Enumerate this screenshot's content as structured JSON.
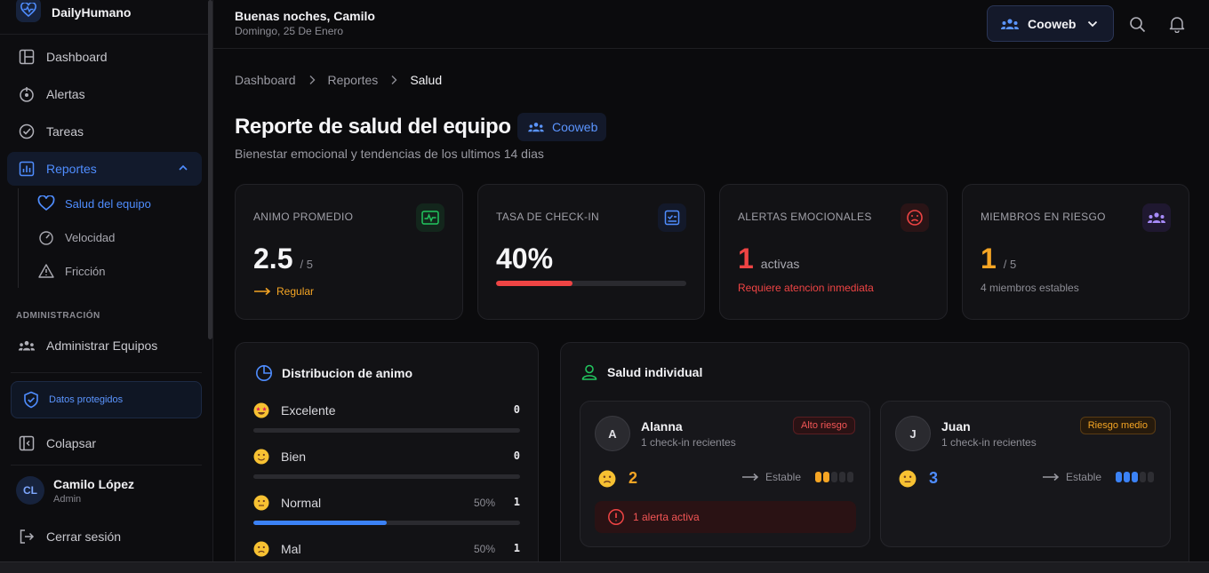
{
  "app": {
    "name": "DailyHumano"
  },
  "sidebar": {
    "items": [
      {
        "label": "Dashboard",
        "icon": "layout-icon"
      },
      {
        "label": "Alertas",
        "icon": "alert-icon"
      },
      {
        "label": "Tareas",
        "icon": "check-circle-icon"
      },
      {
        "label": "Reportes",
        "icon": "bar-chart-icon"
      }
    ],
    "sub_items": [
      {
        "label": "Salud del equipo",
        "icon": "heart-icon"
      },
      {
        "label": "Velocidad",
        "icon": "gauge-icon"
      },
      {
        "label": "Fricción",
        "icon": "warning-icon"
      }
    ],
    "section_label": "ADMINISTRACIÓN",
    "admin_item": "Administrar Equipos",
    "protected_label": "Datos protegidos",
    "collapse_label": "Colapsar",
    "user": {
      "initials": "CL",
      "name": "Camilo López",
      "role": "Admin"
    },
    "logout_label": "Cerrar sesión"
  },
  "topbar": {
    "greeting": "Buenas noches, Camilo",
    "date": "Domingo, 25 De Enero",
    "team": "Cooweb"
  },
  "breadcrumb": [
    "Dashboard",
    "Reportes",
    "Salud"
  ],
  "page": {
    "title": "Reporte de salud del equipo",
    "team_badge": "Cooweb",
    "subtitle": "Bienestar emocional y tendencias de los ultimos 14 dias"
  },
  "stats": {
    "mood": {
      "label": "ANIMO PROMEDIO",
      "value": "2.5",
      "suffix": "/ 5",
      "note": "Regular"
    },
    "checkin": {
      "label": "TASA DE CHECK-IN",
      "value": "40%",
      "progress": 0.4
    },
    "alerts": {
      "label": "ALERTAS EMOCIONALES",
      "value": "1",
      "suffix": "activas",
      "note": "Requiere atencion inmediata"
    },
    "risk": {
      "label": "MIEMBROS EN RIESGO",
      "value": "1",
      "suffix": "/ 5",
      "note": "4 miembros estables"
    }
  },
  "distribution": {
    "title": "Distribucion de animo",
    "rows": [
      {
        "label": "Excelente",
        "pct": "",
        "count": "0",
        "fraction": 0
      },
      {
        "label": "Bien",
        "pct": "",
        "count": "0",
        "fraction": 0
      },
      {
        "label": "Normal",
        "pct": "50%",
        "count": "1",
        "fraction": 0.5
      },
      {
        "label": "Mal",
        "pct": "50%",
        "count": "1",
        "fraction": 0.5
      }
    ]
  },
  "individual": {
    "title": "Salud individual",
    "people": [
      {
        "initial": "A",
        "name": "Alanna",
        "sub": "1 check-in recientes",
        "badge": "Alto riesgo",
        "mood": "2",
        "trend": "Estable",
        "level": 2,
        "alert": "1 alerta activa"
      },
      {
        "initial": "J",
        "name": "Juan",
        "sub": "1 check-in recientes",
        "badge": "Riesgo medio",
        "mood": "3",
        "trend": "Estable",
        "level": 3
      }
    ]
  },
  "colors": {
    "accent": "#4f8dff",
    "danger": "#ef4444",
    "warning": "#f5a524",
    "success": "#22c55e"
  }
}
